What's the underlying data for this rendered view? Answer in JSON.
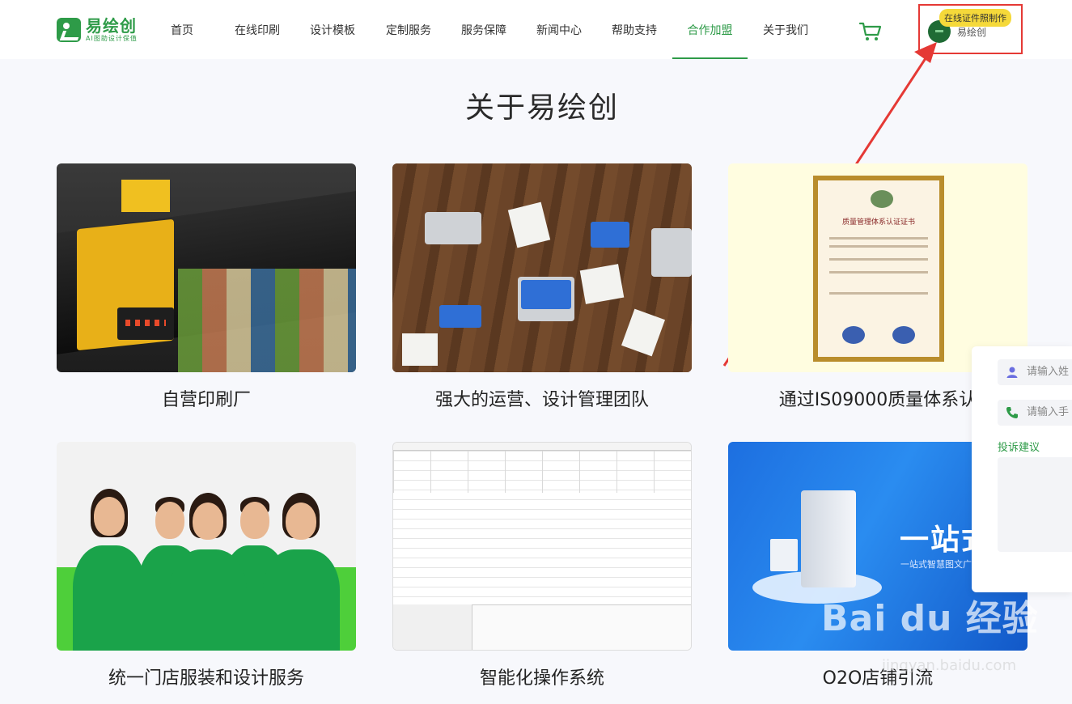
{
  "brand": {
    "name": "易绘创",
    "tagline": "AI图助设计保值"
  },
  "nav": [
    {
      "label": "首页"
    },
    {
      "label": "在线印刷"
    },
    {
      "label": "设计模板"
    },
    {
      "label": "定制服务"
    },
    {
      "label": "服务保障"
    },
    {
      "label": "新闻中心"
    },
    {
      "label": "帮助支持"
    },
    {
      "label": "合作加盟",
      "active": true
    },
    {
      "label": "关于我们"
    }
  ],
  "user": {
    "name": "易绘创",
    "badge": "在线证件照制作"
  },
  "section_title": "关于易绘创",
  "cards": [
    {
      "label": "自营印刷厂"
    },
    {
      "label": "强大的运营、设计管理团队"
    },
    {
      "label": "通过IS09000质量体系认"
    },
    {
      "label": "统一门店服装和设计服务"
    },
    {
      "label": "智能化操作系统"
    },
    {
      "label": "O2O店铺引流"
    }
  ],
  "certificate": {
    "title": "质量管理体系认证证书"
  },
  "o2o_banner": {
    "slogan": "一站式服",
    "subtitle": "一站式智慧图文广告"
  },
  "float_form": {
    "name_placeholder": "请输入姓",
    "phone_placeholder": "请输入手",
    "feedback_label": "投诉建议"
  },
  "watermark": {
    "text": "Bai du 经验",
    "sub": "jingyan.baidu.com"
  },
  "colors": {
    "accent": "#2e9b48",
    "highlight": "#e53935",
    "badge": "#f5d93a"
  }
}
